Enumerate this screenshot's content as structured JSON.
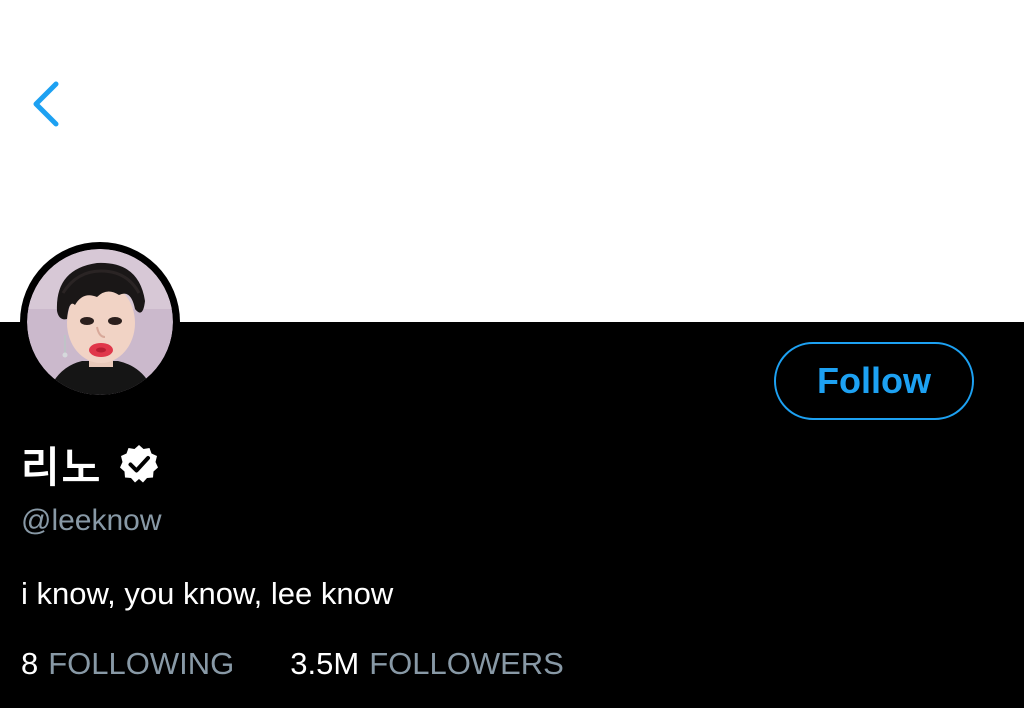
{
  "profile": {
    "display_name": "리노",
    "handle": "@leeknow",
    "bio": "i know, you know, lee know",
    "verified": true
  },
  "actions": {
    "follow_label": "Follow",
    "back_icon": "chevron-left-icon"
  },
  "stats": {
    "following_count": "8",
    "following_label": "FOLLOWING",
    "followers_count": "3.5M",
    "followers_label": "FOLLOWERS"
  },
  "colors": {
    "accent": "#1da1f2",
    "background": "#000000",
    "header": "#ffffff",
    "text_primary": "#ffffff",
    "text_secondary": "#8899a6"
  }
}
